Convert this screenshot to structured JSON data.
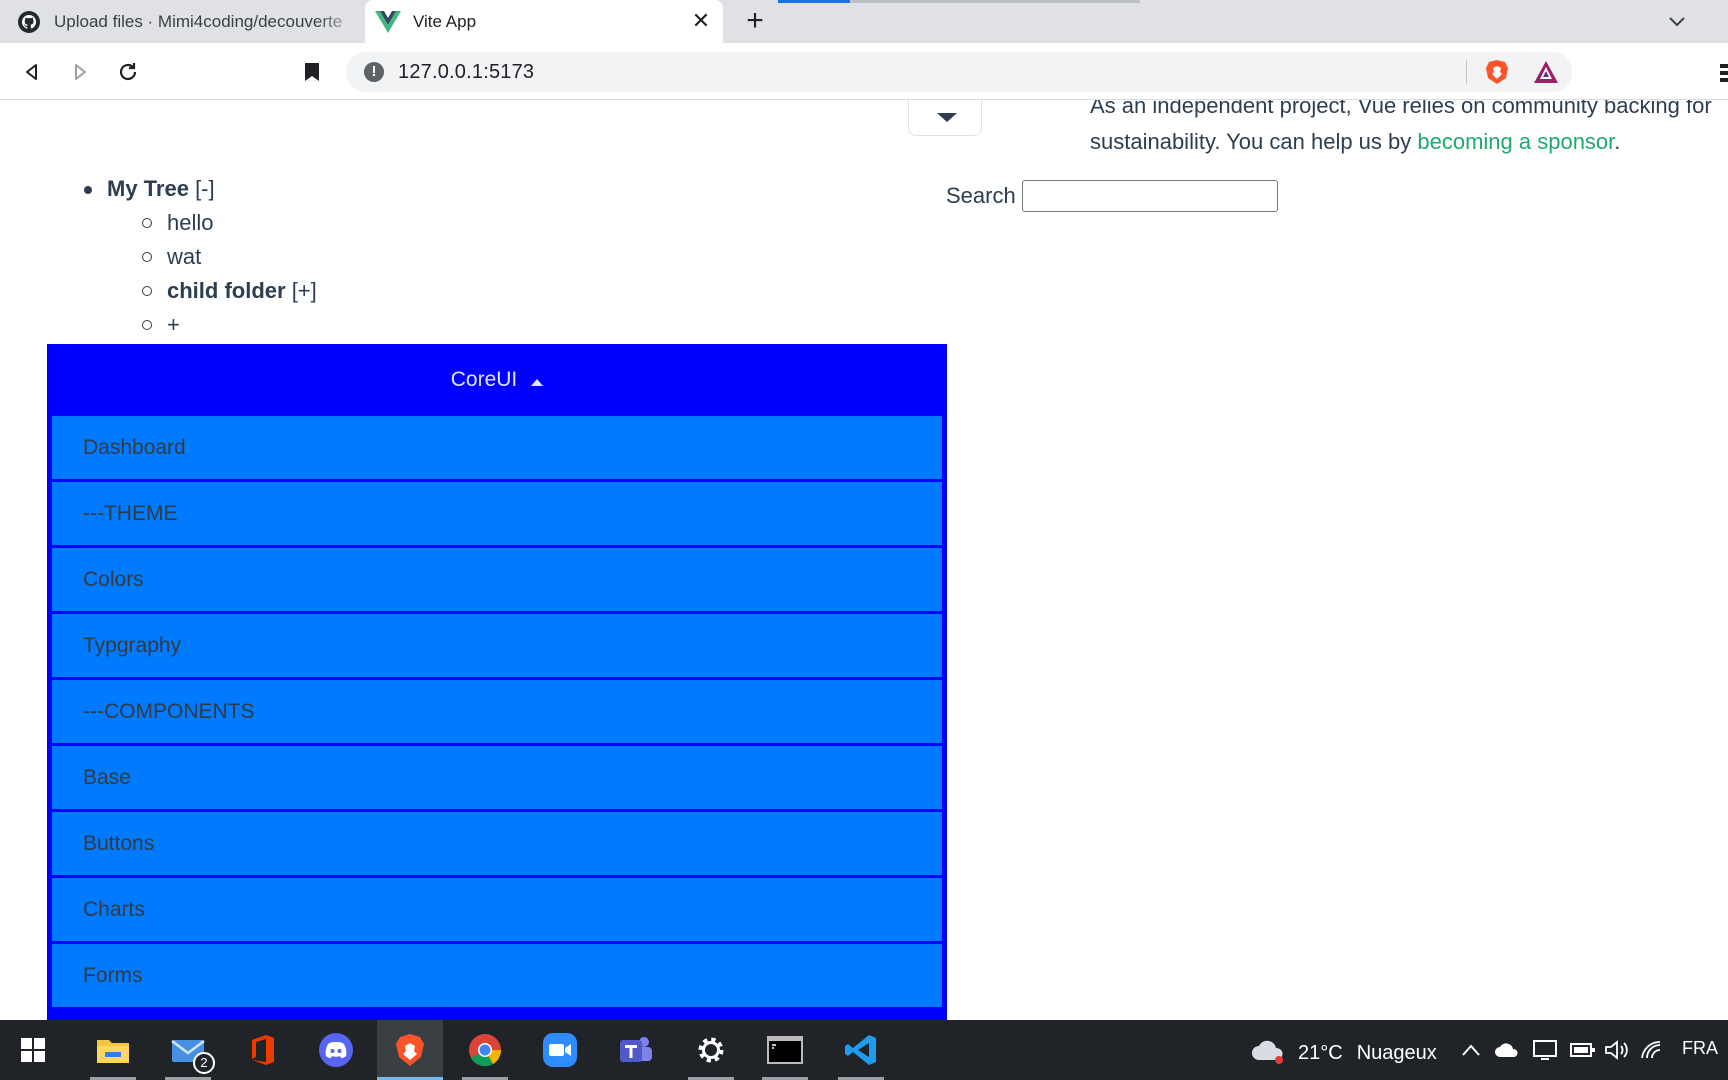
{
  "browser": {
    "tabs": [
      {
        "title": "Upload files · Mimi4coding/decouverte",
        "icon": "github-icon",
        "active": false
      },
      {
        "title": "Vite App",
        "icon": "vue-icon",
        "active": true
      }
    ],
    "new_tab_label": "+",
    "address": "127.0.0.1:5173"
  },
  "page": {
    "sponsor_line1": "As an independent project, Vue relies on community backing for",
    "sponsor_line2_prefix": "sustainability. You can help us by ",
    "sponsor_link": "becoming a sponsor",
    "sponsor_suffix": ".",
    "search_label": "Search",
    "search_value": "",
    "tree": {
      "root_label": "My Tree",
      "root_toggle": "[-]",
      "children": [
        {
          "label": "hello",
          "folder": false
        },
        {
          "label": "wat",
          "folder": false
        },
        {
          "label": "child folder",
          "folder": true,
          "toggle": "[+]"
        },
        {
          "label": "+",
          "folder": false
        }
      ]
    },
    "coreui": {
      "title": "CoreUI",
      "items": [
        "Dashboard",
        "---THEME",
        "Colors",
        "Typgraphy",
        "---COMPONENTS",
        "Base",
        "Buttons",
        "Charts",
        "Forms"
      ]
    }
  },
  "taskbar": {
    "apps": [
      "windows-start",
      "file-explorer",
      "mail",
      "office",
      "discord",
      "brave",
      "chrome",
      "zoom",
      "teams",
      "settings",
      "terminal",
      "vscode"
    ],
    "mail_badge": "2",
    "weather_temp": "21°C",
    "weather_desc": "Nuageux",
    "language": "FRA"
  },
  "colors": {
    "coreui_header": "#0000ff",
    "coreui_item": "#007bff",
    "sponsor_link": "#1eaa6f",
    "taskbar": "#202428"
  }
}
